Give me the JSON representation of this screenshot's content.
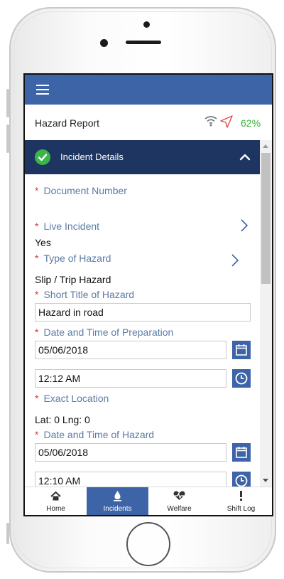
{
  "status_bar": {
    "title": "Hazard Report",
    "battery": "62%"
  },
  "section": {
    "title": "Incident Details"
  },
  "fields": {
    "document_number": {
      "label": "Document Number",
      "value": ""
    },
    "live_incident": {
      "label": "Live Incident",
      "value": "Yes"
    },
    "type_of_hazard": {
      "label": "Type of Hazard",
      "value": "Slip / Trip Hazard"
    },
    "short_title": {
      "label": "Short Title of Hazard",
      "value": "Hazard in road"
    },
    "date_preparation": {
      "label": "Date and Time of Preparation",
      "date": "05/06/2018",
      "time": "12:12 AM"
    },
    "exact_location": {
      "label": "Exact Location",
      "value": "Lat: 0  Lng: 0"
    },
    "date_hazard": {
      "label": "Date and Time of Hazard",
      "date": "05/06/2018",
      "time": "12:10 AM"
    }
  },
  "bottom_nav": [
    {
      "label": "Home",
      "icon": "home-icon",
      "active": false
    },
    {
      "label": "Incidents",
      "icon": "incidents-icon",
      "active": true
    },
    {
      "label": "Welfare",
      "icon": "welfare-icon",
      "active": false
    },
    {
      "label": "Shift Log",
      "icon": "shift-log-icon",
      "active": false
    }
  ],
  "colors": {
    "app_bar": "#3e64a8",
    "section_header": "#1d3560",
    "required_marker": "#d8383c",
    "label_text": "#5b7ba5",
    "battery": "#3bae3b",
    "check": "#3bb54a"
  }
}
